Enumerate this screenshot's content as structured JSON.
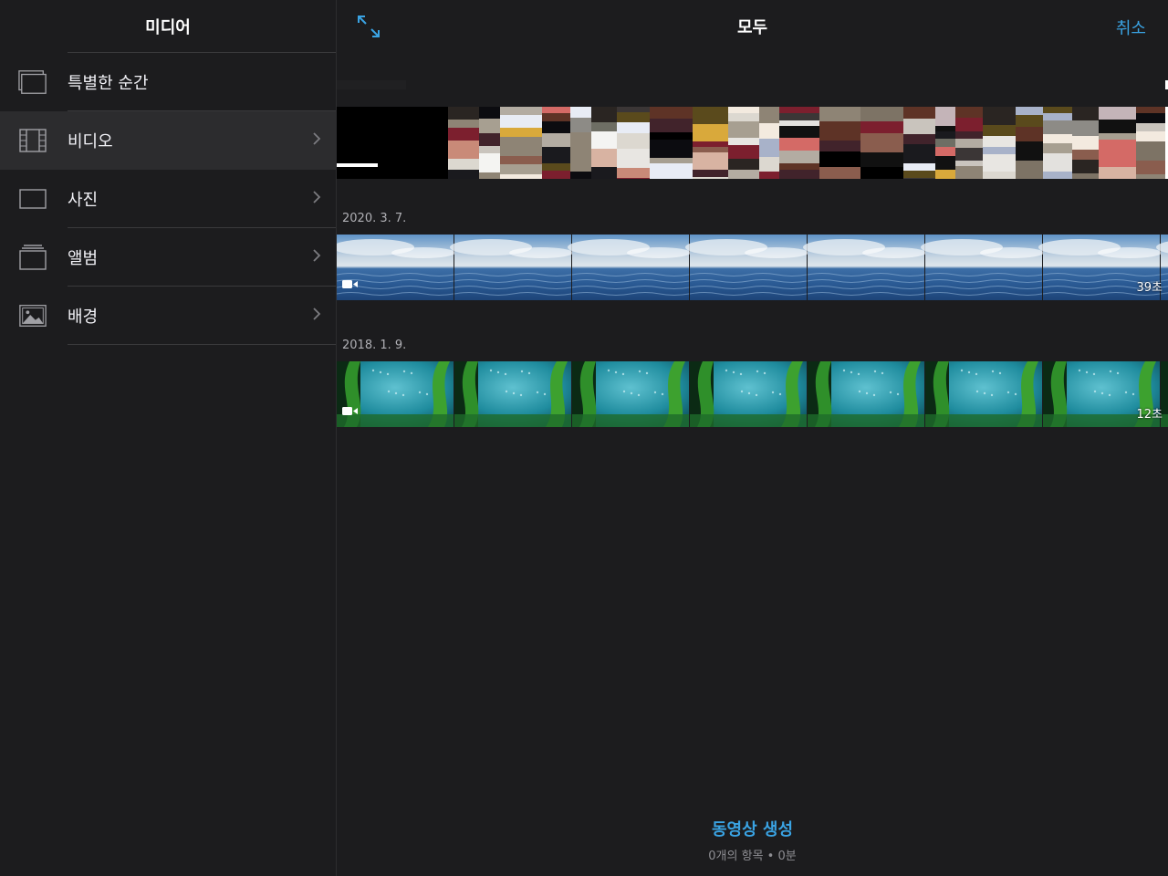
{
  "sidebar": {
    "title": "미디어",
    "items": [
      {
        "label": "특별한 순간",
        "icon": "moments-icon"
      },
      {
        "label": "비디오",
        "icon": "film-icon"
      },
      {
        "label": "사진",
        "icon": "photo-frame-icon"
      },
      {
        "label": "앨범",
        "icon": "album-icon"
      },
      {
        "label": "배경",
        "icon": "landscape-image-icon"
      }
    ]
  },
  "header": {
    "title": "모두",
    "cancel": "취소",
    "expand_icon": "expand-arrows-icon"
  },
  "groups": [
    {
      "date": "2020. 3. 7.",
      "duration": "39초",
      "thumbnail": "ocean"
    },
    {
      "date": "2018. 1. 9.",
      "duration": "12초",
      "thumbnail": "kelp-forest"
    }
  ],
  "footer": {
    "create_label": "동영상 생성",
    "summary": "0개의 항목 • 0분"
  },
  "colors": {
    "accent": "#3aa3e3",
    "background": "#1c1c1e",
    "selected_row": "#2c2c2e"
  }
}
